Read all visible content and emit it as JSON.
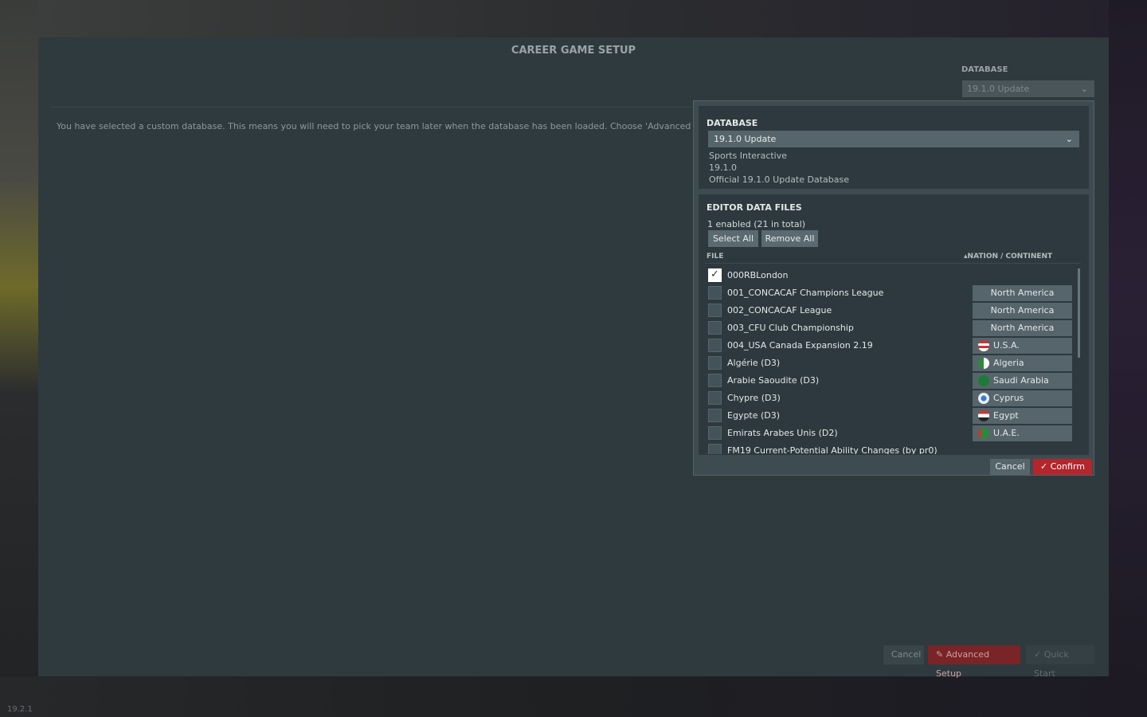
{
  "version": "19.2.1",
  "main": {
    "title": "CAREER GAME SETUP",
    "database_label": "DATABASE",
    "database_selected": "19.1.0 Update",
    "info_text": "You have selected a custom database. This means you will need to pick your team later when the database has been loaded. Choose 'Advanced Setup' now",
    "cancel_label": "Cancel",
    "advanced_label": "Advanced Setup",
    "quick_label": "Quick Start"
  },
  "popup": {
    "database_title": "DATABASE",
    "database_selected": "19.1.0 Update",
    "publisher": "Sports Interactive",
    "db_version": "19.1.0",
    "db_description": "Official 19.1.0 Update Database",
    "files_title": "EDITOR DATA FILES",
    "enabled_count": "1 enabled (21 in total)",
    "select_all": "Select All",
    "remove_all": "Remove All",
    "col_file": "FILE",
    "col_nation": "NATION / CONTINENT",
    "files": [
      {
        "name": "000RBLondon",
        "checked": true,
        "nation": ""
      },
      {
        "name": "001_CONCACAF Champions League",
        "checked": false,
        "nation": "North America"
      },
      {
        "name": "002_CONCACAF League",
        "checked": false,
        "nation": "North America"
      },
      {
        "name": "003_CFU Club Championship",
        "checked": false,
        "nation": "North America"
      },
      {
        "name": "004_USA Canada Expansion 2.19",
        "checked": false,
        "nation": "U.S.A."
      },
      {
        "name": "Algérie (D3)",
        "checked": false,
        "nation": "Algeria"
      },
      {
        "name": "Arabie Saoudite (D3)",
        "checked": false,
        "nation": "Saudi Arabia"
      },
      {
        "name": "Chypre (D3)",
        "checked": false,
        "nation": "Cyprus"
      },
      {
        "name": "Egypte (D3)",
        "checked": false,
        "nation": "Egypt"
      },
      {
        "name": "Emirats Arabes Unis (D2)",
        "checked": false,
        "nation": "U.A.E."
      },
      {
        "name": "FM19 Current-Potential Ability Changes (by pr0)",
        "checked": false,
        "nation": ""
      }
    ],
    "cancel_label": "Cancel",
    "confirm_label": "Confirm"
  }
}
